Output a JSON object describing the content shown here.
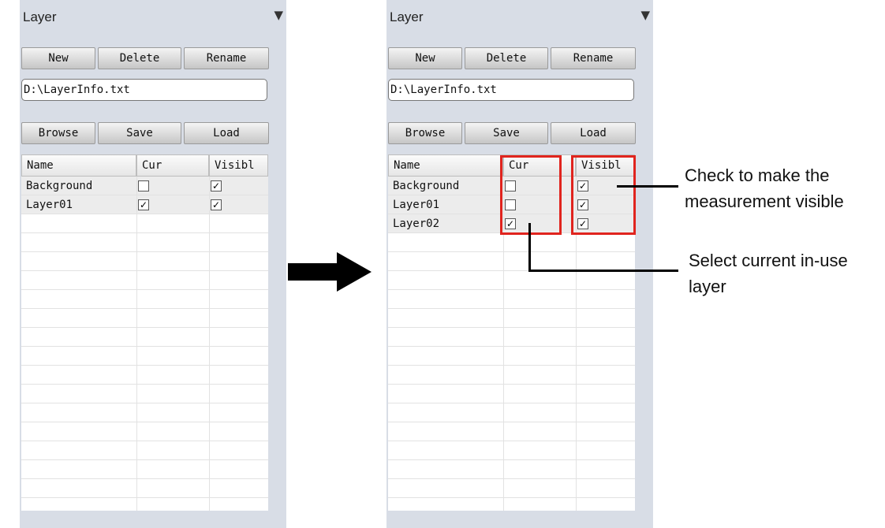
{
  "panel_title": "Layer",
  "menu_icon_glyph": "▼",
  "buttons": {
    "new": "New",
    "delete": "Delete",
    "rename": "Rename",
    "browse": "Browse",
    "save": "Save",
    "load": "Load"
  },
  "path_value": "D:\\LayerInfo.txt",
  "columns": {
    "name": "Name",
    "cur": "Cur",
    "visible": "Visibl"
  },
  "check_glyph": "✓",
  "arrow_glyph": "➡",
  "left_layers": [
    {
      "name": "Background",
      "cur": false,
      "visible": true
    },
    {
      "name": "Layer01",
      "cur": true,
      "visible": true
    }
  ],
  "right_layers": [
    {
      "name": "Background",
      "cur": false,
      "visible": true
    },
    {
      "name": "Layer01",
      "cur": false,
      "visible": true
    },
    {
      "name": "Layer02",
      "cur": true,
      "visible": true
    }
  ],
  "annotations": {
    "visible_line1": "Check to make the",
    "visible_line2": "measurement visible",
    "current_line1": "Select current in-use",
    "current_line2": "layer"
  },
  "colors": {
    "panel_bg": "#d8dde6",
    "highlight_red": "#e0241e"
  }
}
